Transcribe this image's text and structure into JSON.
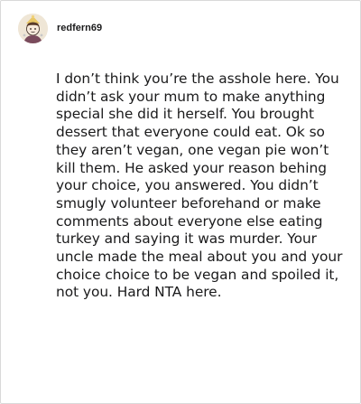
{
  "post": {
    "username": "redfern69",
    "avatar_icon": "user-avatar-icon",
    "body": "I don’t think you’re the asshole here. You didn’t ask your mum to make anything special she did it herself. You brought dessert that everyone could eat. Ok so they aren’t vegan, one vegan pie won’t kill them. He asked your reason behing your choice, you answered. You didn’t smugly volunteer beforehand or make comments about everyone else eating turkey and saying it was murder. Your uncle made the meal about you and your choice choice to be vegan and spoiled it, not you. Hard NTA here."
  }
}
